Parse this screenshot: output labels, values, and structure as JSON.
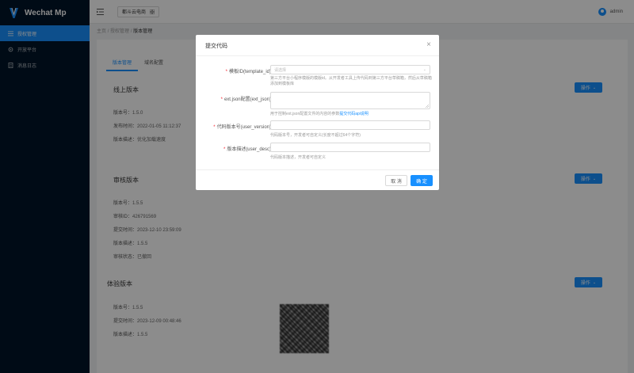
{
  "app": {
    "title": "Wechat Mp",
    "accent": "#1890ff",
    "sidebar_bg": "#001529"
  },
  "sidebar": {
    "items": [
      {
        "label": "授权管理",
        "icon": "list-icon",
        "active": true
      },
      {
        "label": "开放平台",
        "icon": "gear-icon",
        "active": false
      },
      {
        "label": "消息日志",
        "icon": "log-icon",
        "active": false
      }
    ]
  },
  "header": {
    "tenant": "都斗云电商",
    "username": "admin"
  },
  "breadcrumb": {
    "home": "主页",
    "level1": "授权管理",
    "current": "版本管理",
    "sep": "/"
  },
  "tabs": [
    {
      "label": "版本管理",
      "active": true
    },
    {
      "label": "域名配置",
      "active": false
    }
  ],
  "online": {
    "title": "线上版本",
    "op_label": "操作",
    "fields": [
      {
        "label": "版本号：",
        "value": "1.5.0"
      },
      {
        "label": "发布时间：",
        "value": "2022-01-05 11:12:37"
      },
      {
        "label": "版本描述：",
        "value": "优化加载速度"
      }
    ]
  },
  "audit": {
    "title": "审核版本",
    "op_label": "操作",
    "fields": [
      {
        "label": "版本号：",
        "value": "1.5.5"
      },
      {
        "label": "审核ID：",
        "value": "426791569"
      },
      {
        "label": "提交时间：",
        "value": "2023-12-10 23:59:09"
      },
      {
        "label": "版本描述：",
        "value": "1.5.5"
      },
      {
        "label": "审核状态：",
        "value": "已撤回"
      }
    ]
  },
  "trial": {
    "title": "体验版本",
    "op_label": "操作",
    "fields": [
      {
        "label": "版本号：",
        "value": "1.5.5"
      },
      {
        "label": "提交时间：",
        "value": "2023-12-09 00:48:46"
      },
      {
        "label": "版本描述：",
        "value": "1.5.5"
      }
    ]
  },
  "modal": {
    "title": "提交代码",
    "close": "×",
    "template_label": "模板ID(template_id)",
    "template_placeholder": "请选择",
    "template_help": "第三方平台小程序模版的模版id。从开发者工具上传代码到第三方平台草稿箱，然后从草稿箱添加到模板库",
    "ext_label": "ext.json配置(ext_json)",
    "ext_help": "用于控制ext.json配置文件的内容的参数",
    "ext_help_link": "提交代码api说明",
    "version_label": "代码版本号(user_version)",
    "version_help": "代码版本号，开发者可自定义(长度不超过64个字符)",
    "desc_label": "版本描述(user_desc)",
    "desc_help": "代码版本描述，开发者可自定义",
    "cancel": "取 消",
    "ok": "确 定"
  }
}
